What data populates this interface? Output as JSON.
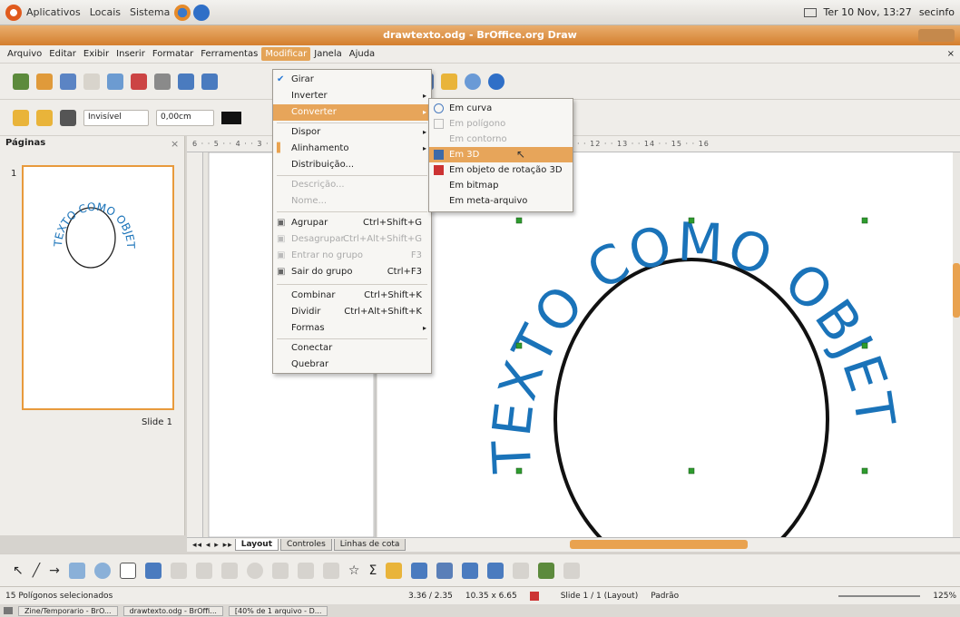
{
  "gnome_panel": {
    "items": [
      "Aplicativos",
      "Locais",
      "Sistema"
    ],
    "datetime": "Ter 10 Nov, 13:27",
    "user": "secinfo"
  },
  "window": {
    "title": "drawtexto.odg - BrOffice.org Draw"
  },
  "menubar": {
    "items": [
      "Arquivo",
      "Editar",
      "Exibir",
      "Inserir",
      "Formatar",
      "Ferramentas",
      "Modificar",
      "Janela",
      "Ajuda"
    ],
    "active": "Modificar"
  },
  "line_toolbar": {
    "line_style": "Invisível",
    "line_width": "0,00cm"
  },
  "pages_panel": {
    "title": "Páginas",
    "slide_number": "1",
    "slide_label": "Slide 1"
  },
  "ruler_top": "6 · · 5 · · 4 · · 3 · · 2 · · 1 · · · · · 1 · · 2 · · 3 · · 4 · · 5 · · 6 · · 7 · · 8 · · 9 · · 10 · · 11 · · 12 · · 13 · · 14 · · 15 · · 16",
  "modificar_menu": {
    "items": [
      {
        "label": "Girar",
        "checked": true
      },
      {
        "label": "Inverter",
        "submenu": true
      },
      {
        "label": "Converter",
        "submenu": true,
        "highlighted": true
      },
      {
        "sep": true
      },
      {
        "label": "Dispor",
        "submenu": true
      },
      {
        "label": "Alinhamento",
        "submenu": true
      },
      {
        "label": "Distribuição..."
      },
      {
        "sep": true
      },
      {
        "label": "Descrição...",
        "disabled": true
      },
      {
        "label": "Nome...",
        "disabled": true
      },
      {
        "sep": true
      },
      {
        "label": "Agrupar",
        "shortcut": "Ctrl+Shift+G"
      },
      {
        "label": "Desagrupar",
        "shortcut": "Ctrl+Alt+Shift+G",
        "disabled": true
      },
      {
        "label": "Entrar no grupo",
        "shortcut": "F3",
        "disabled": true
      },
      {
        "label": "Sair do grupo",
        "shortcut": "Ctrl+F3"
      },
      {
        "sep": true
      },
      {
        "label": "Combinar",
        "shortcut": "Ctrl+Shift+K"
      },
      {
        "label": "Dividir",
        "shortcut": "Ctrl+Alt+Shift+K"
      },
      {
        "label": "Formas",
        "submenu": true
      },
      {
        "sep": true
      },
      {
        "label": "Conectar"
      },
      {
        "label": "Quebrar"
      }
    ]
  },
  "converter_menu": {
    "items": [
      {
        "label": "Em curva"
      },
      {
        "label": "Em polígono",
        "disabled": true
      },
      {
        "label": "Em contorno",
        "disabled": true
      },
      {
        "label": "Em 3D",
        "highlighted": true
      },
      {
        "label": "Em objeto de rotação 3D"
      },
      {
        "label": "Em bitmap"
      },
      {
        "label": "Em meta-arquivo"
      }
    ]
  },
  "canvas": {
    "text_on_path": "TEXTO COMO OBJETO",
    "text_color": "#1a73b9"
  },
  "tabs": {
    "items": [
      "Layout",
      "Controles",
      "Linhas de cota"
    ],
    "active": "Layout"
  },
  "statusbar": {
    "selection": "15 Polígonos selecionados",
    "position": "3.36 / 2.35",
    "size": "10.35 x 6.65",
    "slide": "Slide 1 / 1 (Layout)",
    "style": "Padrão",
    "zoom": "125%"
  },
  "taskbar": {
    "items": [
      "Zine/Temporario - BrO...",
      "drawtexto.odg - BrOffi...",
      "[40% de 1 arquivo - D..."
    ]
  },
  "colors": {
    "accent": "#e7a55a",
    "titlebar": "#d47f2e",
    "blue_text": "#1a73b9"
  }
}
